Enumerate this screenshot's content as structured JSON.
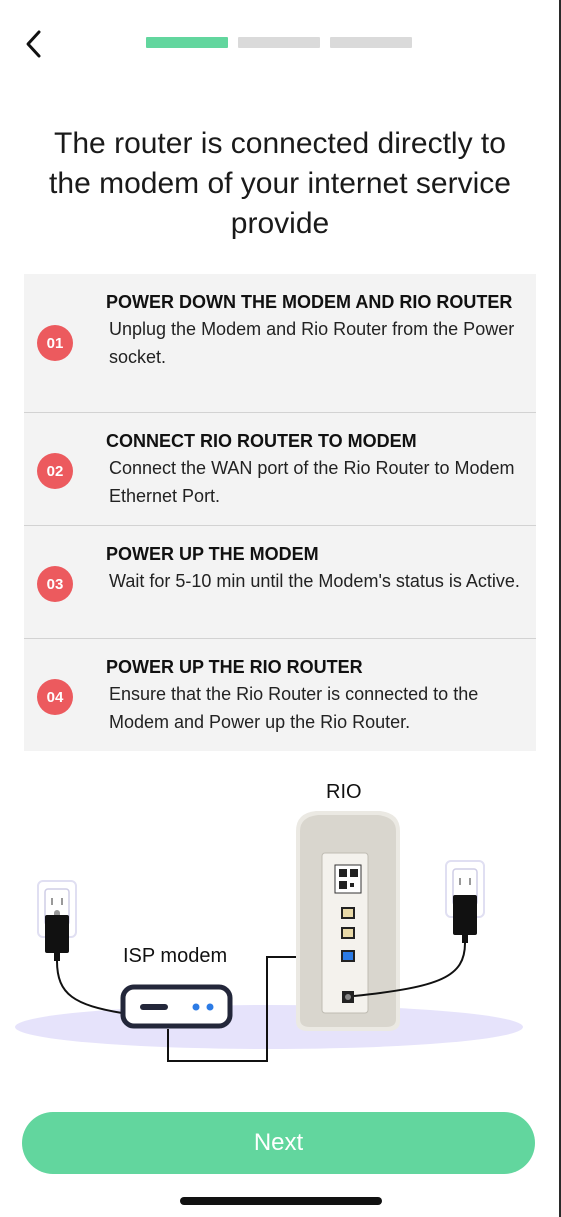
{
  "header": {
    "back_icon": "chevron-left-icon",
    "progress_total": 3,
    "progress_current": 1,
    "progress_active_color": "#62d69e",
    "progress_inactive_color": "#dadada"
  },
  "title": "The router is connected directly to the modem of your internet service provide",
  "steps": [
    {
      "number": "01",
      "title": "POWER DOWN THE  MODEM  AND RIO ROUTER",
      "description": "Unplug the Modem and Rio Router from the Power socket."
    },
    {
      "number": "02",
      "title": "CONNECT RIO ROUTER TO MODEM",
      "description": "Connect the WAN port of the Rio Router to Modem Ethernet Port."
    },
    {
      "number": "03",
      "title": "POWER UP THE MODEM",
      "description": "Wait for 5-10 min until the  Modem's status is Active."
    },
    {
      "number": "04",
      "title": "POWER UP THE RIO ROUTER",
      "description": "Ensure that the Rio Router is connected to the Modem and Power up the Rio Router."
    }
  ],
  "badge_color": "#ec5a5e",
  "illustration": {
    "router_label": "RIO",
    "modem_label": "ISP modem"
  },
  "next_button": {
    "label": "Next",
    "color": "#62d69e"
  }
}
